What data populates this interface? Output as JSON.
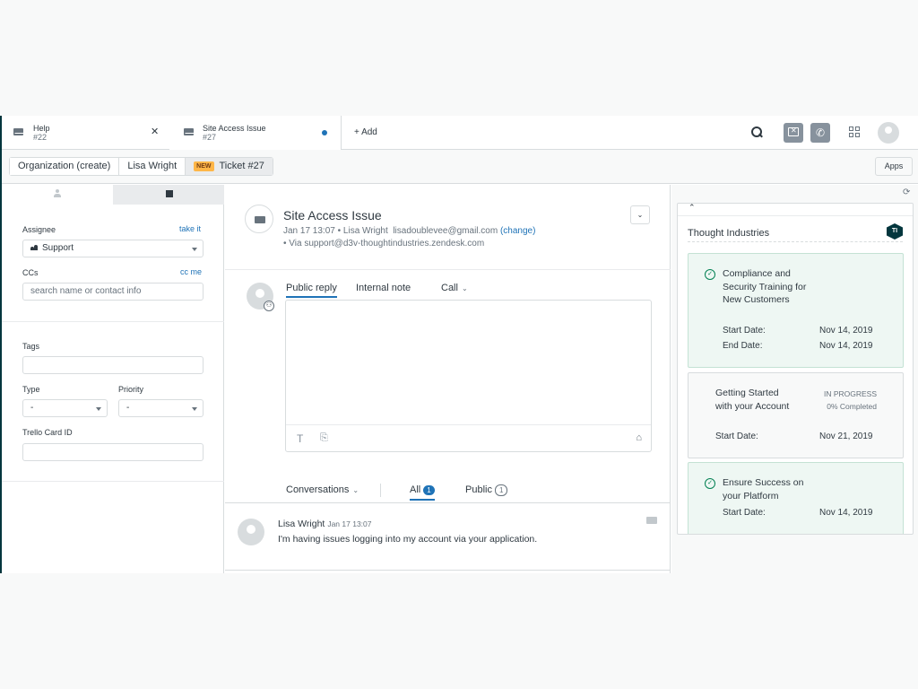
{
  "tabs": [
    {
      "title": "Help",
      "sub": "#22"
    },
    {
      "title": "Site Access Issue",
      "sub": "#27"
    }
  ],
  "add_tab": "+ Add",
  "breadcrumb": {
    "org": "Organization (create)",
    "user": "Lisa Wright",
    "badge": "NEW",
    "ticket": "Ticket #27"
  },
  "apps_label": "Apps",
  "sidebar": {
    "assignee_label": "Assignee",
    "take_it": "take it",
    "assignee_value": "Support",
    "ccs_label": "CCs",
    "cc_me": "cc me",
    "cc_placeholder": "search name or contact info",
    "tags_label": "Tags",
    "type_label": "Type",
    "type_value": "-",
    "priority_label": "Priority",
    "priority_value": "-",
    "trello_label": "Trello Card ID"
  },
  "ticket": {
    "subject": "Site Access Issue",
    "meta_date": "Jan 17 13:07",
    "meta_sep": "•",
    "meta_user": "Lisa Wright",
    "meta_email": "lisadoublevee@gmail.com",
    "change": "(change)",
    "via": "• Via support@d3v-thoughtindustries.zendesk.com"
  },
  "reply": {
    "public": "Public reply",
    "internal": "Internal note",
    "call": "Call"
  },
  "conversations": {
    "label": "Conversations",
    "all": "All",
    "all_count": "1",
    "public": "Public",
    "public_count": "1"
  },
  "message": {
    "author": "Lisa Wright",
    "time": "Jan 17 13:07",
    "text": "I'm having issues logging into my account via your application."
  },
  "app": {
    "title": "Thought Industries",
    "logo": "TI",
    "courses": [
      {
        "name": "Compliance and Security Training for New Customers",
        "start_label": "Start Date:",
        "start": "Nov 14, 2019",
        "end_label": "End Date:",
        "end": "Nov 14, 2019"
      },
      {
        "name": "Getting Started with your Account",
        "status": "IN PROGRESS",
        "completed": "0% Completed",
        "start_label": "Start Date:",
        "start": "Nov 21, 2019"
      },
      {
        "name": "Ensure Success on your Platform",
        "start_label": "Start Date:",
        "start": "Nov 14, 2019"
      }
    ]
  }
}
